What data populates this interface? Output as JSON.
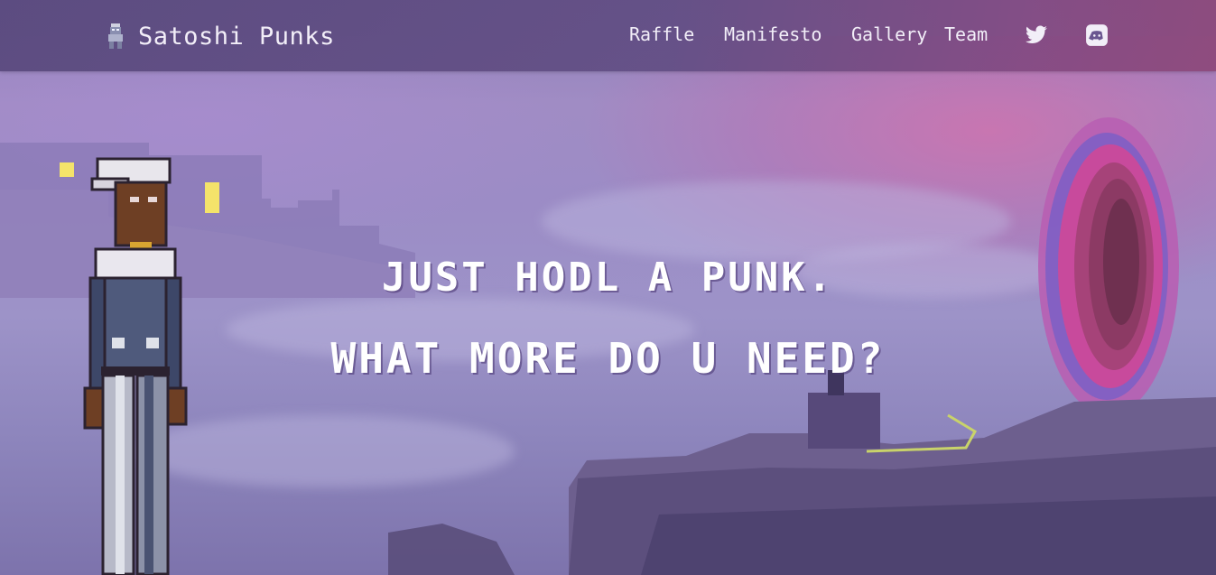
{
  "brand": {
    "title": "Satoshi Punks",
    "logo_icon": "punk-avatar-icon"
  },
  "nav": {
    "links": [
      {
        "label": "Raffle"
      },
      {
        "label": "Manifesto"
      },
      {
        "label": "Gallery"
      },
      {
        "label": "Team"
      }
    ],
    "social": [
      {
        "name": "twitter-icon"
      },
      {
        "name": "discord-icon"
      }
    ]
  },
  "hero": {
    "line1": "JUST HODL A PUNK.",
    "line2": "WHAT MORE DO U NEED?"
  },
  "colors": {
    "nav_bg": "#5e4a82",
    "text": "#ffffff",
    "sky": "#9c8cc6",
    "portal": "#c24aa8"
  }
}
